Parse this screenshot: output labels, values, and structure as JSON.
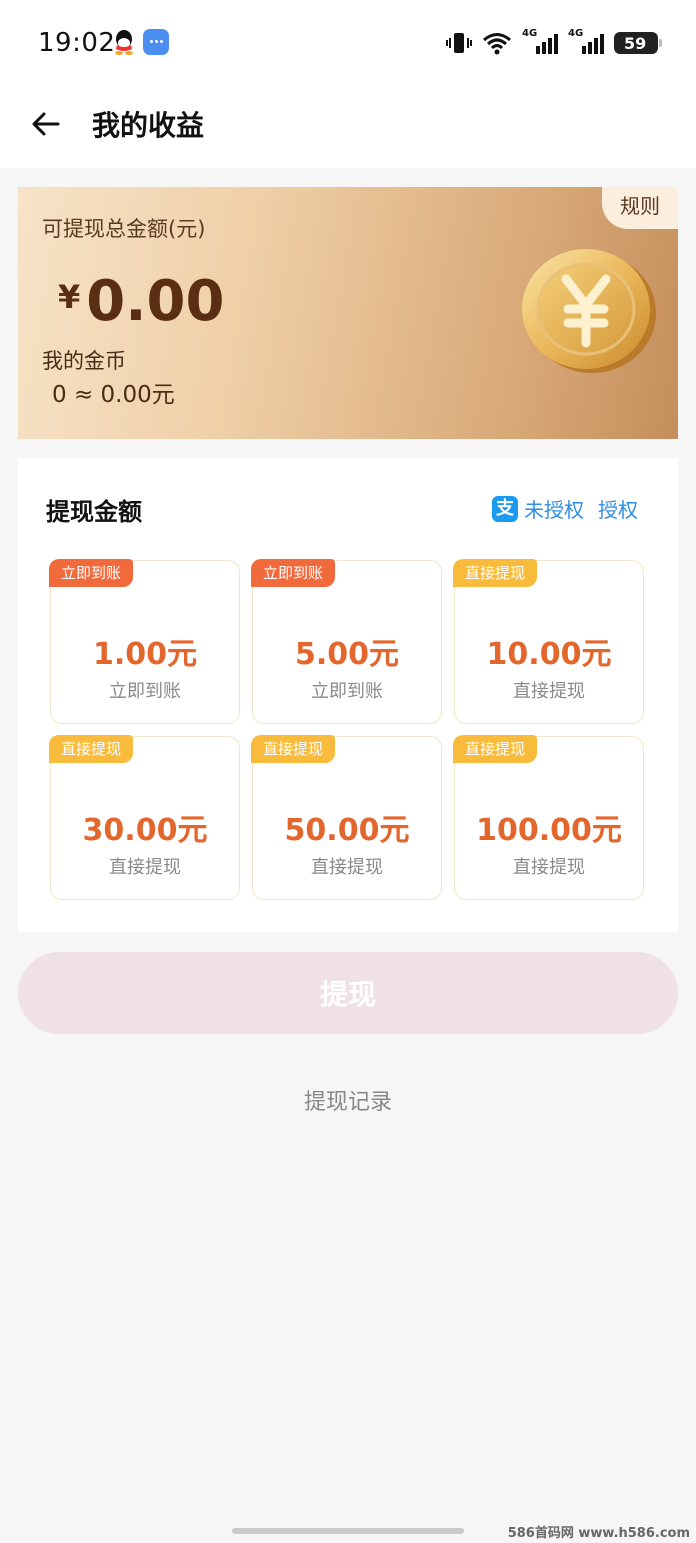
{
  "status_bar": {
    "time": "19:02",
    "network_label_1": "4G",
    "network_label_2": "4G",
    "battery": "59"
  },
  "header": {
    "title": "我的收益"
  },
  "earnings_card": {
    "rule_label": "规则",
    "label": "可提现总金额(元)",
    "currency_symbol": "¥",
    "amount": "0.00",
    "coin_label": "我的金币",
    "coin_value": "0 ≈ 0.00元"
  },
  "withdraw": {
    "title": "提现金额",
    "auth_status": "未授权",
    "auth_action": "授权",
    "options": [
      {
        "tag": "立即到账",
        "amount": "1.00元",
        "desc": "立即到账"
      },
      {
        "tag": "立即到账",
        "amount": "5.00元",
        "desc": "立即到账"
      },
      {
        "tag": "直接提现",
        "amount": "10.00元",
        "desc": "直接提现"
      },
      {
        "tag": "直接提现",
        "amount": "30.00元",
        "desc": "直接提现"
      },
      {
        "tag": "直接提现",
        "amount": "50.00元",
        "desc": "直接提现"
      },
      {
        "tag": "直接提现",
        "amount": "100.00元",
        "desc": "直接提现"
      }
    ],
    "button_label": "提现",
    "records_label": "提现记录"
  },
  "watermark": "586首码网 www.h586.com",
  "colors": {
    "accent_orange": "#e3662c",
    "tag_instant": "#f06a3c",
    "tag_direct": "#f9bb3c",
    "alipay_blue": "#2d8ee6",
    "button_disabled": "#efe1e5"
  }
}
